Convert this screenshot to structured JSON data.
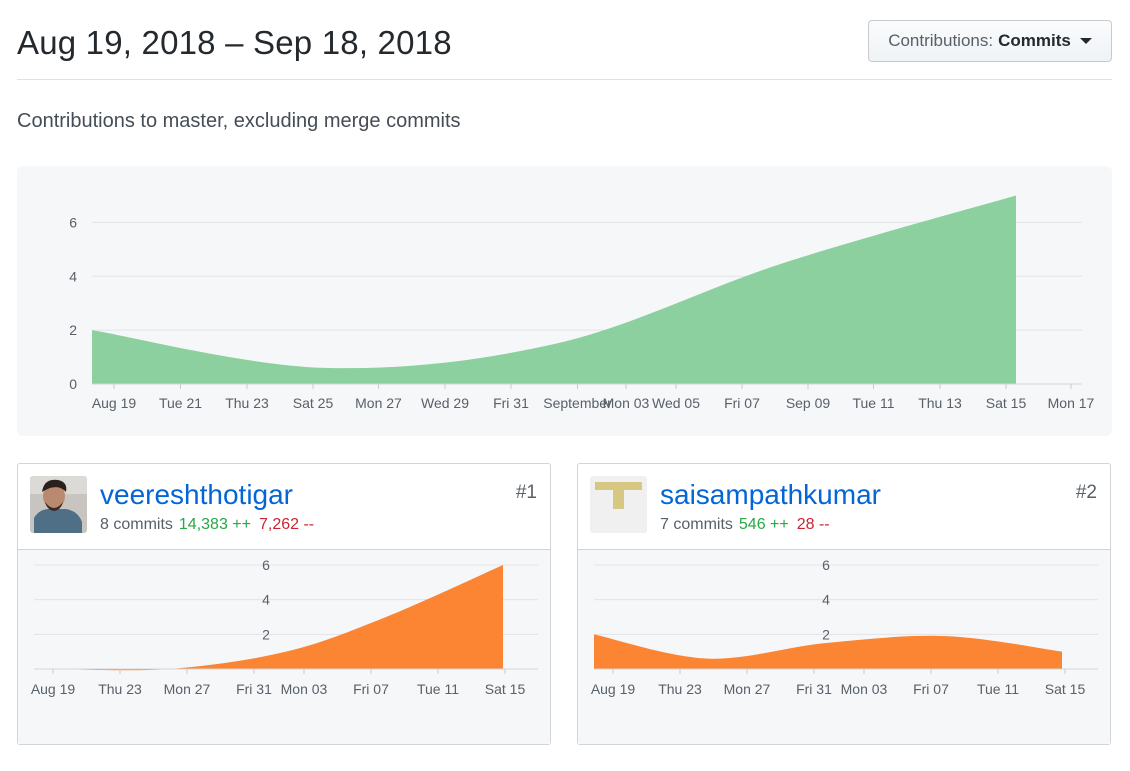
{
  "header": {
    "date_range": "Aug 19, 2018 – Sep 18, 2018",
    "contributions_label": "Contributions:",
    "contributions_value": "Commits"
  },
  "subtitle": "Contributions to master, excluding merge commits",
  "colors": {
    "main_area": "#8cd09f",
    "user_area": "#fb8532",
    "link": "#0366d6",
    "additions": "#28a745",
    "deletions": "#cb2431"
  },
  "chart_data": [
    {
      "type": "area",
      "title": "",
      "x_tick_labels": [
        "Aug 19",
        "Tue 21",
        "Thu 23",
        "Sat 25",
        "Mon 27",
        "Wed 29",
        "Fri 31",
        "September",
        "Mon 03",
        "Wed 05",
        "Fri 07",
        "Sep 09",
        "Tue 11",
        "Thu 13",
        "Sat 15",
        "Mon 17"
      ],
      "x": [
        "Aug 19",
        "Aug 26",
        "Sep 02",
        "Sep 09",
        "Sep 16"
      ],
      "y_ticks": [
        0,
        2,
        4,
        6
      ],
      "ylim": [
        0,
        7
      ],
      "grid": true,
      "series": [
        {
          "values": [
            2,
            0.6,
            1.5,
            4.5,
            7
          ]
        }
      ]
    },
    {
      "type": "area",
      "user": "veereshthotigar",
      "x_tick_labels": [
        "Aug 19",
        "Thu 23",
        "Mon 27",
        "Fri 31",
        "Mon 03",
        "Fri 07",
        "Tue 11",
        "Sat 15"
      ],
      "x": [
        "Aug 19",
        "Aug 26",
        "Sep 02",
        "Sep 09",
        "Sep 16"
      ],
      "y_ticks": [
        2,
        4,
        6
      ],
      "ylim": [
        0,
        6
      ],
      "grid": true,
      "series": [
        {
          "values": [
            0,
            0,
            1,
            3,
            6
          ]
        }
      ]
    },
    {
      "type": "area",
      "user": "saisampathkumar",
      "x_tick_labels": [
        "Aug 19",
        "Thu 23",
        "Mon 27",
        "Fri 31",
        "Mon 03",
        "Fri 07",
        "Tue 11",
        "Sat 15"
      ],
      "x": [
        "Aug 19",
        "Aug 26",
        "Sep 02",
        "Sep 09",
        "Sep 16"
      ],
      "y_ticks": [
        2,
        4,
        6
      ],
      "ylim": [
        0,
        6
      ],
      "grid": true,
      "series": [
        {
          "values": [
            2,
            0.6,
            1.5,
            1.9,
            1
          ]
        }
      ]
    }
  ],
  "contributors": [
    {
      "rank": "#1",
      "name": "veereshthotigar",
      "commits": "8 commits",
      "additions": "14,383 ++",
      "deletions": "7,262 --",
      "avatar": "photo-avatar"
    },
    {
      "rank": "#2",
      "name": "saisampathkumar",
      "commits": "7 commits",
      "additions": "546 ++",
      "deletions": "28 --",
      "avatar": "identicon-avatar"
    }
  ]
}
